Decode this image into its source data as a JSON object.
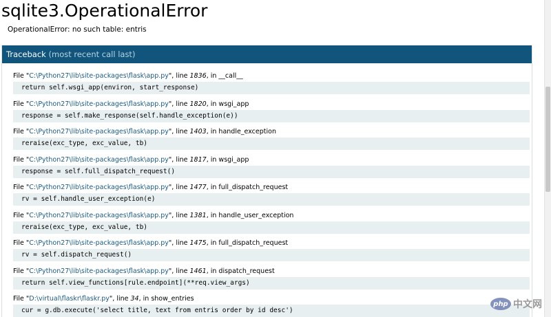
{
  "error": {
    "title": "sqlite3.OperationalError",
    "message": "OperationalError: no such table: entris"
  },
  "traceback": {
    "header_main": "Traceback ",
    "header_dim": "(most recent call last)",
    "frames": [
      {
        "file_prefix": "File \"",
        "path": "C:\\Python27\\lib\\site-packages\\flask\\app.py",
        "line_prefix": "\", line ",
        "line": "1836",
        "in_prefix": ", in ",
        "func": "__call__",
        "code": "return self.wsgi_app(environ, start_response)"
      },
      {
        "file_prefix": "File \"",
        "path": "C:\\Python27\\lib\\site-packages\\flask\\app.py",
        "line_prefix": "\", line ",
        "line": "1820",
        "in_prefix": ", in ",
        "func": "wsgi_app",
        "code": "response = self.make_response(self.handle_exception(e))"
      },
      {
        "file_prefix": "File \"",
        "path": "C:\\Python27\\lib\\site-packages\\flask\\app.py",
        "line_prefix": "\", line ",
        "line": "1403",
        "in_prefix": ", in ",
        "func": "handle_exception",
        "code": "reraise(exc_type, exc_value, tb)"
      },
      {
        "file_prefix": "File \"",
        "path": "C:\\Python27\\lib\\site-packages\\flask\\app.py",
        "line_prefix": "\", line ",
        "line": "1817",
        "in_prefix": ", in ",
        "func": "wsgi_app",
        "code": "response = self.full_dispatch_request()"
      },
      {
        "file_prefix": "File \"",
        "path": "C:\\Python27\\lib\\site-packages\\flask\\app.py",
        "line_prefix": "\", line ",
        "line": "1477",
        "in_prefix": ", in ",
        "func": "full_dispatch_request",
        "code": "rv = self.handle_user_exception(e)"
      },
      {
        "file_prefix": "File \"",
        "path": "C:\\Python27\\lib\\site-packages\\flask\\app.py",
        "line_prefix": "\", line ",
        "line": "1381",
        "in_prefix": ", in ",
        "func": "handle_user_exception",
        "code": "reraise(exc_type, exc_value, tb)"
      },
      {
        "file_prefix": "File \"",
        "path": "C:\\Python27\\lib\\site-packages\\flask\\app.py",
        "line_prefix": "\", line ",
        "line": "1475",
        "in_prefix": ", in ",
        "func": "full_dispatch_request",
        "code": "rv = self.dispatch_request()"
      },
      {
        "file_prefix": "File \"",
        "path": "C:\\Python27\\lib\\site-packages\\flask\\app.py",
        "line_prefix": "\", line ",
        "line": "1461",
        "in_prefix": ", in ",
        "func": "dispatch_request",
        "code": "return self.view_functions[rule.endpoint](**req.view_args)"
      },
      {
        "file_prefix": "File \"",
        "path": "D:\\virtual\\flaskr\\flaskr.py",
        "line_prefix": "\", line ",
        "line": "34",
        "in_prefix": ", in ",
        "func": "show_entries",
        "code": "cur = g.db.execute('select title, text from entris order by id desc')"
      }
    ]
  },
  "watermark": {
    "logo": "php",
    "text": "中文网"
  },
  "colors": {
    "header_bg": "#11557c",
    "code_bg": "#e8eff0",
    "path_link": "#1b5b7f"
  }
}
